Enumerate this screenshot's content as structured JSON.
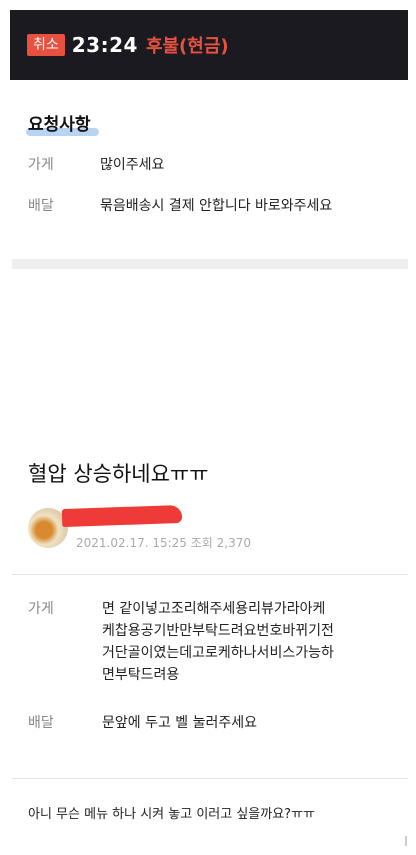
{
  "header": {
    "cancel_label": "취소",
    "order_time": "23:24",
    "payment_type": "후불(현금)"
  },
  "requests": {
    "title": "요청사항",
    "store_label": "가게",
    "store_value": "많이주세요",
    "delivery_label": "배달",
    "delivery_value": "묶음배송시 결제 안합니다 바로와주세요"
  },
  "post": {
    "title": "혈압 상승하네요ㅠㅠ",
    "date": "2021.02.17. 15:25",
    "views_label": "조회",
    "views": "2,370"
  },
  "detail": {
    "store_label": "가게",
    "store_lines": [
      "면 같이넣고조리해주세용리뷰가라아케",
      "케찹용공기반만부탁드려요번호바뀌기전",
      "거단골이였는데고로케하나서비스가능하",
      "면부탁드려용"
    ],
    "delivery_label": "배달",
    "delivery_value": "문앞에 두고 벨 눌러주세요"
  },
  "comment": "아니 무슨 메뉴 하나 시켜 놓고 이러고 싶을까요?ㅠㅠ",
  "colors": {
    "header_bg": "#1b1a20",
    "accent_red": "#e8513f",
    "highlight_blue": "#b9d4f3"
  }
}
